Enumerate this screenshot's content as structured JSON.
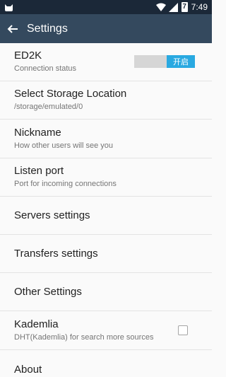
{
  "status_bar": {
    "time": "7:49",
    "battery_level": "7",
    "left_icon": "notification-cat-icon",
    "right_icons": [
      "wifi-icon",
      "signal-icon",
      "battery-icon"
    ]
  },
  "app_bar": {
    "title": "Settings",
    "back_icon": "back-arrow-icon"
  },
  "settings": {
    "ed2k": {
      "title": "ED2K",
      "subtitle": "Connection status",
      "toggle_label": "开启",
      "toggle_on": true
    },
    "storage": {
      "title": "Select Storage Location",
      "subtitle": "/storage/emulated/0"
    },
    "nickname": {
      "title": "Nickname",
      "subtitle": "How other users will see you"
    },
    "listen_port": {
      "title": "Listen port",
      "subtitle": "Port for incoming connections"
    },
    "servers": {
      "title": "Servers settings"
    },
    "transfers": {
      "title": "Transfers settings"
    },
    "other": {
      "title": "Other Settings"
    },
    "kademlia": {
      "title": "Kademlia",
      "subtitle": "DHT(Kademlia) for search more sources",
      "checked": false
    },
    "about": {
      "title": "About"
    }
  },
  "colors": {
    "status_bar": "#1b2838",
    "app_bar": "#34495e",
    "toggle_on": "#29a9e1",
    "toggle_track": "#d6d6d6"
  }
}
